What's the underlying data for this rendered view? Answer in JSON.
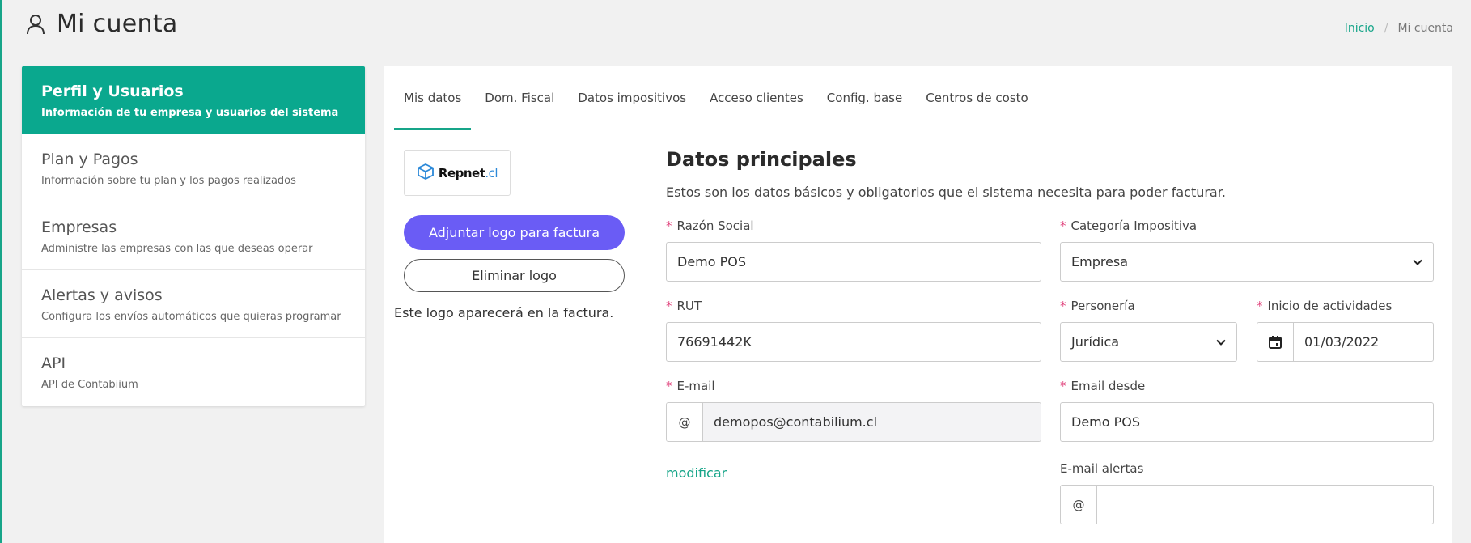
{
  "header": {
    "title": "Mi cuenta",
    "user_icon": "user-icon"
  },
  "breadcrumb": {
    "home": "Inicio",
    "separator": "/",
    "current": "Mi cuenta"
  },
  "sidebar": {
    "items": [
      {
        "title": "Perfil y Usuarios",
        "desc": "Información de tu empresa y usuarios del sistema",
        "active": true
      },
      {
        "title": "Plan y Pagos",
        "desc": "Información sobre tu plan y los pagos realizados"
      },
      {
        "title": "Empresas",
        "desc": "Administre las empresas con las que deseas operar"
      },
      {
        "title": "Alertas y avisos",
        "desc": "Configura los envíos automáticos que quieras programar"
      },
      {
        "title": "API",
        "desc": "API de Contabiium"
      }
    ]
  },
  "tabs": [
    {
      "label": "Mis datos",
      "active": true
    },
    {
      "label": "Dom. Fiscal"
    },
    {
      "label": "Datos impositivos"
    },
    {
      "label": "Acceso clientes"
    },
    {
      "label": "Config. base"
    },
    {
      "label": "Centros de costo"
    }
  ],
  "logo": {
    "brand": "Repnet",
    "brand_suffix": ".cl",
    "upload_label": "Adjuntar logo para factura",
    "remove_label": "Eliminar logo",
    "note": "Este logo aparecerá en la factura."
  },
  "form": {
    "title": "Datos principales",
    "description": "Estos son los datos básicos y obligatorios que el sistema necesita para poder facturar.",
    "required_mark": "*",
    "razon_social": {
      "label": "Razón Social",
      "value": "Demo POS"
    },
    "categoria": {
      "label": "Categoría Impositiva",
      "value": "Empresa"
    },
    "rut": {
      "label": "RUT",
      "value": "76691442K"
    },
    "personeria": {
      "label": "Personería",
      "value": "Jurídica"
    },
    "inicio": {
      "label": "Inicio de actividades",
      "value": "01/03/2022"
    },
    "email": {
      "label": "E-mail",
      "prefix": "@",
      "value": "demopos@contabilium.cl"
    },
    "email_desde": {
      "label": "Email desde",
      "value": "Demo POS"
    },
    "modificar": "modificar",
    "email_alertas": {
      "label": "E-mail alertas",
      "prefix": "@",
      "value": ""
    }
  },
  "colors": {
    "accent": "#17a589",
    "active_sidebar": "#0aa88e",
    "primary_button": "#6a5cf5",
    "required": "#e0407a"
  }
}
